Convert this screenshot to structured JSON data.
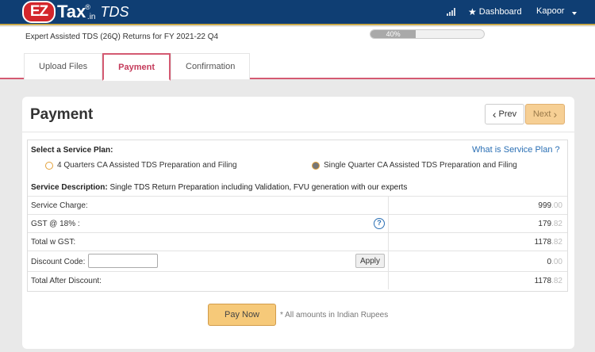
{
  "app": {
    "logo_ez": "EZ",
    "logo_tax": "Tax",
    "logo_reg": "®",
    "logo_in": ".in",
    "logo_product": "TDS"
  },
  "navbar": {
    "signal_icon": "bar-chart-icon",
    "dashboard_label": "Dashboard",
    "user_label": "Kapoor"
  },
  "subheader": {
    "title": "Expert Assisted TDS (26Q) Returns for FY 2021-22 Q4",
    "progress_text": "40%",
    "progress_value": 40
  },
  "tabs": [
    {
      "label": "Upload Files",
      "active": false
    },
    {
      "label": "Payment",
      "active": true
    },
    {
      "label": "Confirmation",
      "active": false
    }
  ],
  "payment": {
    "title": "Payment",
    "prev_label": "Prev",
    "next_label": "Next",
    "plan_label": "Select a Service Plan:",
    "what_link": "What is Service Plan ?",
    "plans": [
      {
        "label": "4 Quarters CA Assisted TDS Preparation and Filing",
        "selected": false
      },
      {
        "label": "Single Quarter CA Assisted TDS Preparation and Filing",
        "selected": true
      }
    ],
    "description_label": "Service Description:",
    "description_text": "Single TDS Return Preparation including Validation, FVU generation with our experts",
    "lines": {
      "service_charge": {
        "label": "Service Charge:",
        "int": "999",
        "dec": ".00"
      },
      "gst": {
        "label": "GST @ 18% :",
        "int": "179",
        "dec": ".82"
      },
      "total_gst": {
        "label": "Total w GST:",
        "int": "1178",
        "dec": ".82"
      },
      "discount": {
        "label": "Discount Code:",
        "int": "0",
        "dec": ".00",
        "input_value": "",
        "apply_label": "Apply"
      },
      "total_after": {
        "label": "Total After Discount:",
        "int": "1178",
        "dec": ".82"
      }
    },
    "pay_label": "Pay Now",
    "note": "* All amounts in Indian Rupees"
  }
}
